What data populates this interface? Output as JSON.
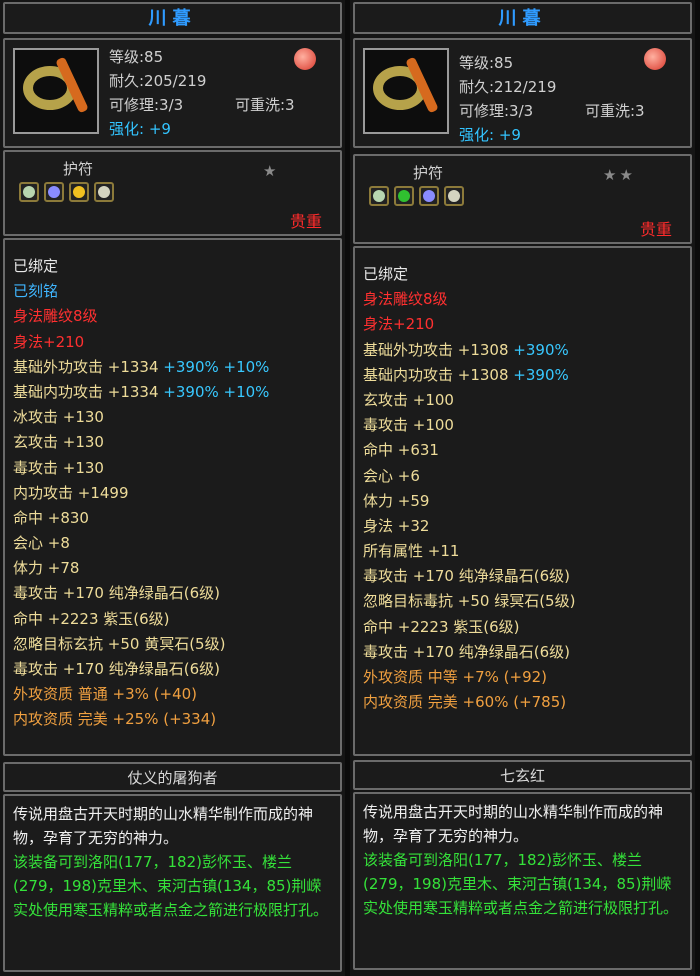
{
  "left": {
    "title": "川暮",
    "level": "等级:85",
    "durability": "耐久:205/219",
    "repairable": "可修理:3/3",
    "rewashable": "可重洗:3",
    "enhance_label": "强化:",
    "enhance_value": "+9",
    "amulet_label": "护符",
    "stars": "★",
    "precious": "贵重",
    "slot_colors": [
      "#b8d6b0",
      "#8a8cff",
      "#f0c020",
      "#d4d4c0"
    ],
    "attrs": [
      {
        "text": "已绑定",
        "color": "white"
      },
      {
        "text": "已刻铭",
        "color": "blue"
      },
      {
        "text": "身法雕纹8级",
        "color": "red"
      },
      {
        "text": "身法+210",
        "color": "red"
      },
      {
        "text": "基础外功攻击 +1334",
        "extra": "+390% +10%",
        "color": "yellow"
      },
      {
        "text": "基础内功攻击 +1334",
        "extra": "+390% +10%",
        "color": "yellow"
      },
      {
        "text": "冰攻击 +130",
        "color": "yellow"
      },
      {
        "text": "玄攻击 +130",
        "color": "yellow"
      },
      {
        "text": "毒攻击 +130",
        "color": "yellow"
      },
      {
        "text": "内功攻击 +1499",
        "color": "yellow"
      },
      {
        "text": "命中 +830",
        "color": "yellow"
      },
      {
        "text": "会心 +8",
        "color": "yellow"
      },
      {
        "text": "体力 +78",
        "color": "yellow"
      },
      {
        "text": "毒攻击 +170 纯净绿晶石(6级)",
        "color": "yellow"
      },
      {
        "text": "命中 +2223 紫玉(6级)",
        "color": "yellow"
      },
      {
        "text": "忽略目标玄抗 +50 黄冥石(5级)",
        "color": "yellow"
      },
      {
        "text": "毒攻击 +170 纯净绿晶石(6级)",
        "color": "yellow"
      },
      {
        "text": "外攻资质  普通 +3% (+40)",
        "color": "orange"
      },
      {
        "text": "内攻资质  完美 +25% (+334)",
        "color": "orange"
      }
    ],
    "set_name": "仗义的屠狗者",
    "desc_white": "传说用盘古开天时期的山水精华制作而成的神物，孕育了无穷的神力。",
    "desc_green": "该装备可到洛阳(177，182)彭怀玉、楼兰(279，198)克里木、束河古镇(134，85)荆嵘实处使用寒玉精粹或者点金之箭进行极限打孔。"
  },
  "right": {
    "title": "川暮",
    "level": "等级:85",
    "durability": "耐久:212/219",
    "repairable": "可修理:3/3",
    "rewashable": "可重洗:3",
    "enhance_label": "强化:",
    "enhance_value": "+9",
    "amulet_label": "护符",
    "stars": "★★",
    "precious": "贵重",
    "slot_colors": [
      "#b8d6b0",
      "#30c030",
      "#8a8cff",
      "#d4d4c0"
    ],
    "attrs": [
      {
        "text": "已绑定",
        "color": "white"
      },
      {
        "text": "身法雕纹8级",
        "color": "red"
      },
      {
        "text": "身法+210",
        "color": "red"
      },
      {
        "text": "基础外功攻击 +1308",
        "extra": "+390%",
        "color": "yellow"
      },
      {
        "text": "基础内功攻击 +1308",
        "extra": "+390%",
        "color": "yellow"
      },
      {
        "text": "玄攻击 +100",
        "color": "yellow"
      },
      {
        "text": "毒攻击 +100",
        "color": "yellow"
      },
      {
        "text": "命中 +631",
        "color": "yellow"
      },
      {
        "text": "会心 +6",
        "color": "yellow"
      },
      {
        "text": "体力 +59",
        "color": "yellow"
      },
      {
        "text": "身法 +32",
        "color": "yellow"
      },
      {
        "text": "所有属性 +11",
        "color": "yellow"
      },
      {
        "text": "毒攻击 +170 纯净绿晶石(6级)",
        "color": "yellow"
      },
      {
        "text": "忽略目标毒抗 +50 绿冥石(5级)",
        "color": "yellow"
      },
      {
        "text": "命中 +2223 紫玉(6级)",
        "color": "yellow"
      },
      {
        "text": "毒攻击 +170 纯净绿晶石(6级)",
        "color": "yellow"
      },
      {
        "text": "外攻资质  中等 +7% (+92)",
        "color": "orange"
      },
      {
        "text": "内攻资质  完美 +60% (+785)",
        "color": "orange"
      }
    ],
    "set_name": "七玄红",
    "desc_white": "传说用盘古开天时期的山水精华制作而成的神物，孕育了无穷的神力。",
    "desc_green": "该装备可到洛阳(177，182)彭怀玉、楼兰(279，198)克里木、束河古镇(134，85)荆嵘实处使用寒玉精粹或者点金之箭进行极限打孔。"
  }
}
